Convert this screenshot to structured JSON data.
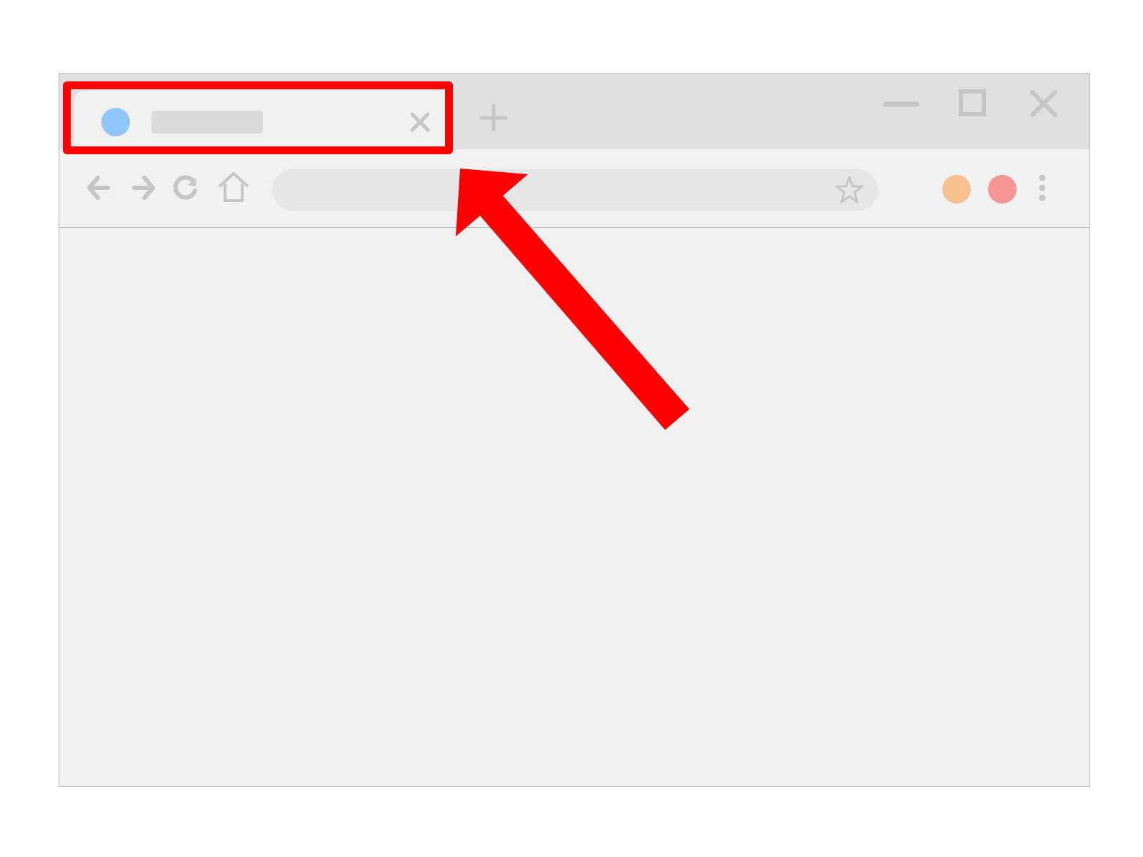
{
  "browser": {
    "tab": {
      "title": "",
      "favicon_color": "#90c5f9",
      "close_icon": "close-icon"
    },
    "new_tab_icon": "plus-icon",
    "window_controls": [
      "minimize-icon",
      "maximize-icon",
      "close-icon"
    ],
    "toolbar": {
      "icons": [
        "back-arrow-icon",
        "forward-arrow-icon",
        "reload-icon",
        "home-icon"
      ],
      "address_bar": {
        "value": "",
        "bookmark_icon": "star-icon"
      },
      "extensions": [
        {
          "name": "extension-orange",
          "color": "#f9c091"
        },
        {
          "name": "extension-red",
          "color": "#f69595"
        }
      ],
      "menu_icon": "vertical-dots-icon"
    },
    "icon_color": "#c6c6c6"
  },
  "annotation": {
    "highlight_color": "#ff0000",
    "highlight_target": "tab",
    "arrow_color": "#ff0000"
  }
}
